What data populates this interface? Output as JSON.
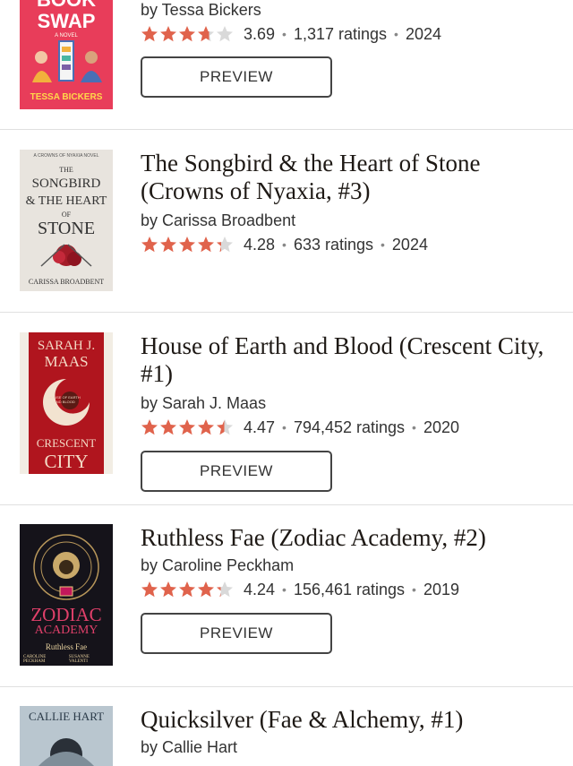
{
  "colors": {
    "star": "#e0634c",
    "star_empty": "#d9d9d9",
    "divider": "#e0e0e0"
  },
  "books": [
    {
      "title": "",
      "author": "by Tessa Bickers",
      "rating": 3.69,
      "rating_text": "3.69",
      "ratings_count": "1,317 ratings",
      "year": "2024",
      "preview": "PREVIEW",
      "cover": {
        "lines": [
          "BOOK",
          "SWAP"
        ],
        "small": "A NOVEL",
        "author": "TESSA BICKERS"
      }
    },
    {
      "title": "The Songbird & the Heart of Stone (Crowns of Nyaxia, #3)",
      "author": "by Carissa Broadbent",
      "rating": 4.28,
      "rating_text": "4.28",
      "ratings_count": "633 ratings",
      "year": "2024",
      "preview": "",
      "cover": {
        "top": "A CROWNS OF NYAXIA NOVEL",
        "lines": [
          "THE",
          "SONGBIRD",
          "& THE HEART",
          "OF",
          "STONE"
        ],
        "author": "CARISSA BROADBENT"
      }
    },
    {
      "title": "House of Earth and Blood (Crescent City, #1)",
      "author": "by Sarah J. Maas",
      "rating": 4.47,
      "rating_text": "4.47",
      "ratings_count": "794,452 ratings",
      "year": "2020",
      "preview": "PREVIEW",
      "cover": {
        "lines": [
          "SARAH J.",
          "MAAS"
        ],
        "mid": "HOUSE OF EARTH AND BLOOD",
        "bottom": [
          "CRESCENT",
          "CITY"
        ]
      }
    },
    {
      "title": "Ruthless Fae (Zodiac Academy, #2)",
      "author": "by Caroline Peckham",
      "rating": 4.24,
      "rating_text": "4.24",
      "ratings_count": "156,461 ratings",
      "year": "2019",
      "preview": "PREVIEW",
      "cover": {
        "lines": [
          "ZODIAC",
          "ACADEMY"
        ],
        "subtitle": "Ruthless Fae",
        "author_left": "CAROLINE PECKHAM",
        "author_right": "SUSANNE VALENTI"
      }
    },
    {
      "title": "Quicksilver (Fae & Alchemy, #1)",
      "author": "by Callie Hart",
      "rating": null,
      "rating_text": "",
      "ratings_count": "",
      "year": "",
      "preview": "",
      "cover": {
        "lines": [
          "CALLIE HART"
        ]
      }
    }
  ]
}
